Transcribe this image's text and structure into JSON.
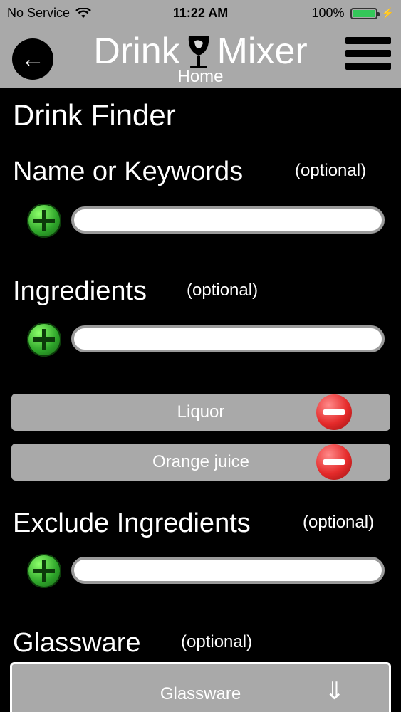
{
  "status_bar": {
    "carrier": "No Service",
    "time": "11:22 AM",
    "battery_percent": "100%"
  },
  "nav": {
    "title_left": "Drink",
    "title_right": "Mixer",
    "subtitle": "Home",
    "back_icon": "back-arrow-icon",
    "menu_icon": "hamburger-menu-icon"
  },
  "page": {
    "title": "Drink Finder",
    "name_keywords": {
      "label": "Name or Keywords",
      "optional": "(optional)",
      "value": ""
    },
    "ingredients": {
      "label": "Ingredients",
      "optional": "(optional)",
      "value": "",
      "items": [
        {
          "label": "Liquor"
        },
        {
          "label": "Orange juice"
        }
      ]
    },
    "exclude_ingredients": {
      "label": "Exclude Ingredients",
      "optional": "(optional)",
      "value": ""
    },
    "glassware": {
      "label": "Glassware",
      "optional": "(optional)",
      "selected": "Glassware",
      "arrow": "⇓"
    }
  },
  "colors": {
    "bar_gray": "#a9a9a9",
    "background": "#000000",
    "add_green": "#2ea52a",
    "remove_red": "#e52b2b",
    "battery_green": "#34c759"
  }
}
